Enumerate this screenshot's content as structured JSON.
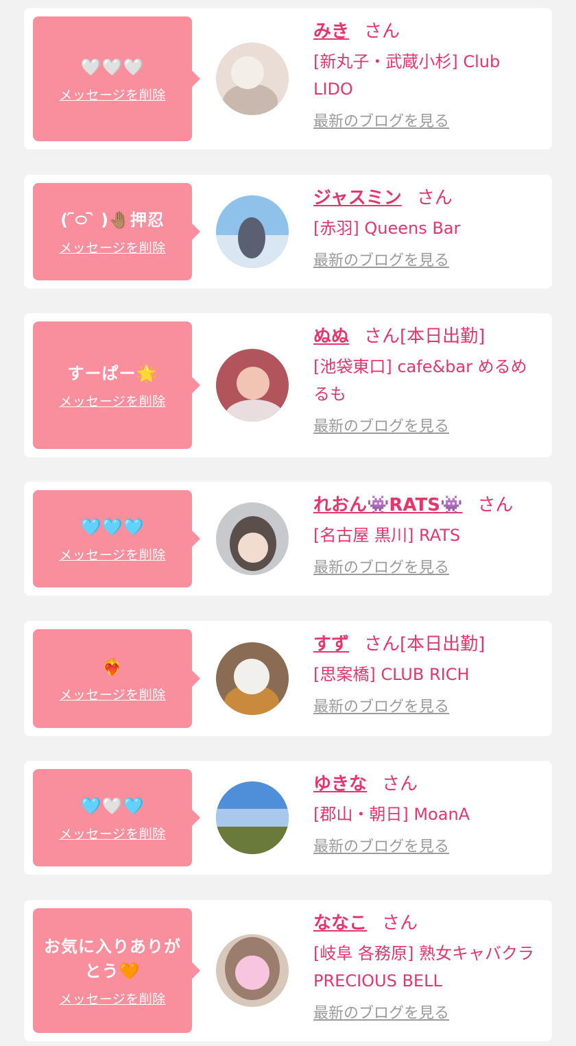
{
  "cards": [
    {
      "message": "🤍🤍🤍",
      "delete_label": "メッセージを削除",
      "name": "みき",
      "honorific": "さん",
      "status": "",
      "shop": "[新丸子・武蔵小杉] Club LIDO",
      "blog_label": "最新のブログを見る",
      "avatar_colors": [
        "#e9ddd6",
        "#c9b8ad",
        "#f4eee9"
      ]
    },
    {
      "message": "( ᷇࿀ ᷆ )🤚🏽押忍",
      "delete_label": "メッセージを削除",
      "name": "ジャスミン",
      "honorific": "さん",
      "status": "",
      "shop": "[赤羽] Queens Bar",
      "blog_label": "最新のブログを見る",
      "avatar_colors": [
        "#8ec2ea",
        "#d9e7f3",
        "#5b5f72"
      ]
    },
    {
      "message": "すーぱー🌟",
      "delete_label": "メッセージを削除",
      "name": "ぬぬ",
      "honorific": "さん",
      "status": "[本日出勤]",
      "shop": "[池袋東口] cafe&bar めるめるも",
      "blog_label": "最新のブログを見る",
      "avatar_colors": [
        "#b2545c",
        "#f2c4b4",
        "#e9dde0"
      ]
    },
    {
      "message": "🩵🩵🩵",
      "delete_label": "メッセージを削除",
      "name": "れおん👾RATS👾",
      "honorific": "さん",
      "status": "",
      "shop": "[名古屋 黒川] RATS",
      "blog_label": "最新のブログを見る",
      "avatar_colors": [
        "#c7c9cd",
        "#5b4f4c",
        "#f2dcd0"
      ]
    },
    {
      "message": "❤️‍🔥",
      "delete_label": "メッセージを削除",
      "name": "すず",
      "honorific": "さん",
      "status": "[本日出勤]",
      "shop": "[思案橋] CLUB RICH",
      "blog_label": "最新のブログを見る",
      "avatar_colors": [
        "#8a6b53",
        "#f2f0ec",
        "#c98a3b"
      ]
    },
    {
      "message": "🩵🤍🩵",
      "delete_label": "メッセージを削除",
      "name": "ゆきな",
      "honorific": "さん",
      "status": "",
      "shop": "[郡山・朝日] MoanA",
      "blog_label": "最新のブログを見る",
      "avatar_colors": [
        "#4f8fd9",
        "#a8c8ee",
        "#6a7a3a"
      ]
    },
    {
      "message": "お気に入りありがとう🧡",
      "delete_label": "メッセージを削除",
      "name": "ななこ",
      "honorific": "さん",
      "status": "",
      "shop": "[岐阜 各務原]  熟女キャバクラ PRECIOUS BELL",
      "blog_label": "最新のブログを見る",
      "avatar_colors": [
        "#9a7d6c",
        "#f7c5de",
        "#d8c8bc"
      ]
    }
  ]
}
